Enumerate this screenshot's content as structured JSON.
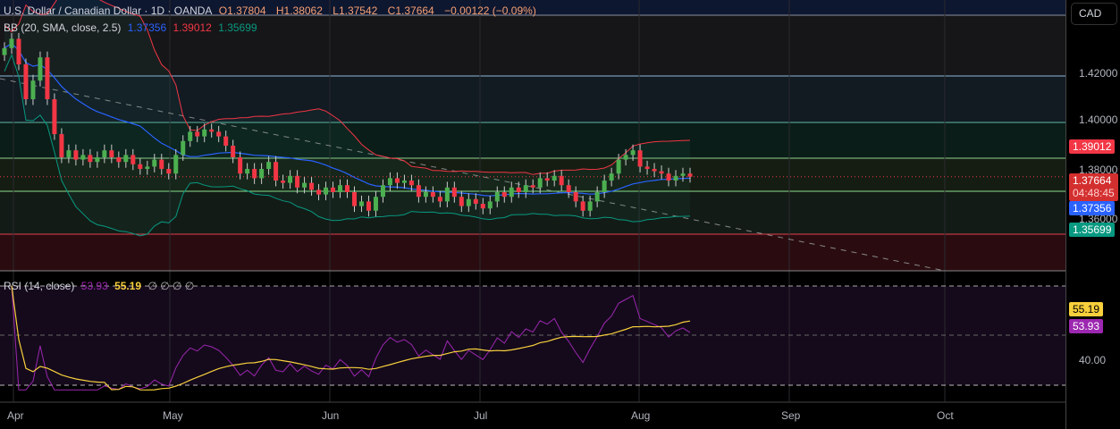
{
  "header": {
    "symbol": "U.S. Dollar / Canadian Dollar · 1D · OANDA",
    "open_label": "O",
    "open": "1.37804",
    "high_label": "H",
    "high": "1.38062",
    "low_label": "L",
    "low": "1.37542",
    "close_label": "C",
    "close": "1.37664",
    "change": "−0.00122 (−0.09%)"
  },
  "bb_legend": {
    "label": "BB (20, SMA, close, 2.5)",
    "basis": "1.37356",
    "upper": "1.39012",
    "lower": "1.35699"
  },
  "rsi_legend": {
    "label": "RSI (14, close)",
    "rsi": "53.93",
    "ma": "55.19",
    "extra": "∅ ∅ ∅ ∅"
  },
  "currency_button": "CAD",
  "price_axis": [
    "1.42000",
    "1.40000",
    "1.38000",
    "1.36000"
  ],
  "price_tags": {
    "upper": "1.39012",
    "last": "1.37664",
    "countdown": "04:48:45",
    "basis": "1.37356",
    "lower": "1.35699"
  },
  "rsi_axis": [
    "40.00"
  ],
  "rsi_tags": {
    "ma": "55.19",
    "rsi": "53.93"
  },
  "time_axis": [
    "Apr",
    "May",
    "Jun",
    "Jul",
    "Aug",
    "Sep",
    "Oct"
  ],
  "colors": {
    "up": "#4caf50",
    "down": "#f23645",
    "basis": "#2962ff",
    "upper": "#f23645",
    "lower": "#089981",
    "rsi": "#9c27b0",
    "rsi_ma": "#f7d03c"
  },
  "chart_data": {
    "type": "candlestick",
    "title": "U.S. Dollar / Canadian Dollar · 1D · OANDA",
    "ylim": [
      1.333,
      1.446
    ],
    "closes": [
      1.432,
      1.436,
      1.425,
      1.41,
      1.418,
      1.428,
      1.41,
      1.395,
      1.385,
      1.388,
      1.384,
      1.386,
      1.383,
      1.385,
      1.388,
      1.385,
      1.383,
      1.386,
      1.382,
      1.38,
      1.381,
      1.384,
      1.38,
      1.378,
      1.386,
      1.392,
      1.396,
      1.394,
      1.397,
      1.396,
      1.394,
      1.39,
      1.385,
      1.378,
      1.38,
      1.376,
      1.38,
      1.383,
      1.375,
      1.374,
      1.377,
      1.372,
      1.374,
      1.371,
      1.369,
      1.372,
      1.37,
      1.373,
      1.37,
      1.364,
      1.366,
      1.362,
      1.368,
      1.373,
      1.376,
      1.374,
      1.375,
      1.373,
      1.368,
      1.37,
      1.368,
      1.366,
      1.372,
      1.368,
      1.364,
      1.367,
      1.365,
      1.363,
      1.366,
      1.37,
      1.368,
      1.372,
      1.37,
      1.373,
      1.372,
      1.376,
      1.375,
      1.377,
      1.373,
      1.37,
      1.366,
      1.362,
      1.366,
      1.37,
      1.375,
      1.378,
      1.384,
      1.386,
      1.388,
      1.381,
      1.38,
      1.379,
      1.378,
      1.375,
      1.377,
      1.378,
      1.37664
    ],
    "horizontal_levels": [
      1.42,
      1.4,
      1.385,
      1.3705,
      1.3518
    ],
    "rsi_levels": [
      70,
      50,
      30
    ]
  }
}
